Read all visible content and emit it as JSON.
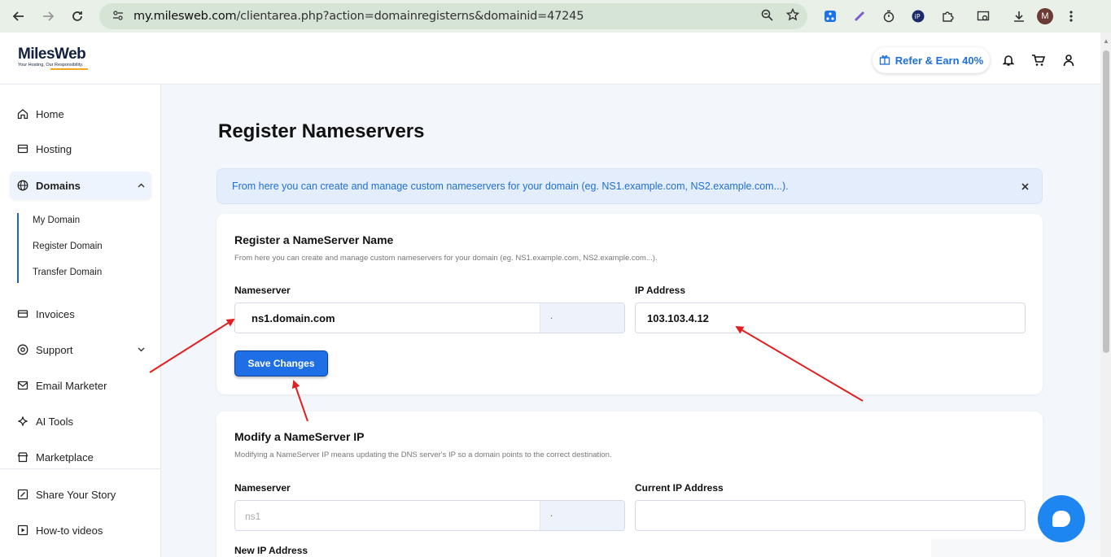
{
  "browser": {
    "url_host": "my.milesweb.com",
    "url_path": "/clientarea.php?action=domainregisterns&domainid=47245",
    "profile_initial": "M"
  },
  "header": {
    "logo_name": "MilesWeb",
    "logo_tagline": "Your Hosting, Our Responsibility.",
    "refer_label": "Refer & Earn 40%"
  },
  "sidebar": {
    "items": [
      {
        "label": "Home",
        "icon": "home-icon"
      },
      {
        "label": "Hosting",
        "icon": "server-icon"
      },
      {
        "label": "Domains",
        "icon": "globe-icon"
      },
      {
        "label": "Invoices",
        "icon": "invoice-icon"
      },
      {
        "label": "Support",
        "icon": "support-icon"
      },
      {
        "label": "Email Marketer",
        "icon": "mail-icon"
      },
      {
        "label": "AI Tools",
        "icon": "sparkle-icon"
      },
      {
        "label": "Marketplace",
        "icon": "store-icon"
      },
      {
        "label": "Share Your Story",
        "icon": "edit-icon"
      },
      {
        "label": "How-to videos",
        "icon": "play-icon"
      }
    ],
    "domains_sub": [
      "My Domain",
      "Register Domain",
      "Transfer Domain"
    ]
  },
  "main": {
    "title": "Register Nameservers",
    "alert": "From here you can create and manage custom nameservers for your domain (eg. NS1.example.com, NS2.example.com...).",
    "register": {
      "title": "Register a NameServer Name",
      "desc": "From here you can create and manage custom nameservers for your domain (eg. NS1.example.com, NS2.example.com...).",
      "ns_label": "Nameserver",
      "ns_value": "ns1.domain.com",
      "ns_suffix": ".",
      "ip_label": "IP Address",
      "ip_value": "103.103.4.12",
      "save_label": "Save Changes"
    },
    "modify": {
      "title": "Modify a NameServer IP",
      "desc": "Modifying a NameServer IP means updating the DNS server's IP so a domain points to the correct destination.",
      "ns_label": "Nameserver",
      "ns_placeholder": "ns1",
      "ns_suffix": ".",
      "current_ip_label": "Current IP Address",
      "new_ip_label": "New IP Address"
    }
  },
  "colors": {
    "accent": "#1e6fe6",
    "annotation_arrow": "#e02020"
  }
}
